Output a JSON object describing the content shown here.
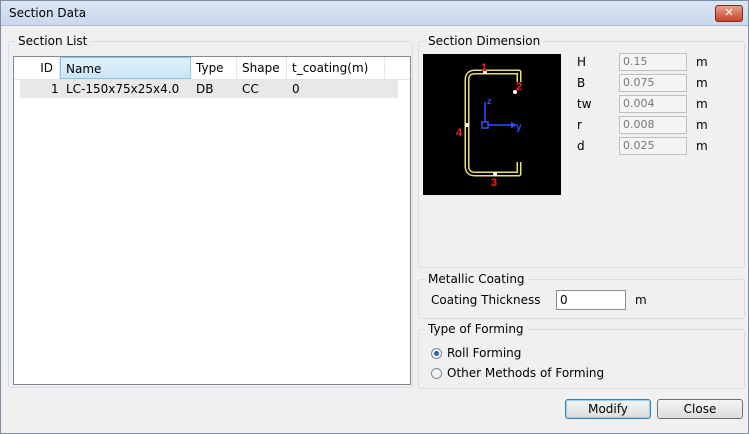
{
  "window": {
    "title": "Section Data",
    "close_symbol": "✕"
  },
  "section_list": {
    "label": "Section List",
    "columns": [
      "ID",
      "Name",
      "Type",
      "Shape",
      "t_coating(m)"
    ],
    "rows": [
      {
        "id": "1",
        "name": "LC-150x75x25x4.0",
        "type": "DB",
        "shape": "CC",
        "t_coating": "0"
      }
    ]
  },
  "section_dimension": {
    "label": "Section Dimension",
    "preview": {
      "axis_z": "z",
      "axis_y": "y",
      "point_1": "1",
      "point_2": "2",
      "point_3": "3",
      "point_4": "4"
    },
    "fields": [
      {
        "name": "H",
        "value": "0.15",
        "unit": "m"
      },
      {
        "name": "B",
        "value": "0.075",
        "unit": "m"
      },
      {
        "name": "tw",
        "value": "0.004",
        "unit": "m"
      },
      {
        "name": "r",
        "value": "0.008",
        "unit": "m"
      },
      {
        "name": "d",
        "value": "0.025",
        "unit": "m"
      }
    ]
  },
  "metallic_coating": {
    "label": "Metallic Coating",
    "thickness_label": "Coating Thickness",
    "thickness_value": "0",
    "unit": "m"
  },
  "forming": {
    "label": "Type of Forming",
    "options": [
      {
        "label": "Roll Forming",
        "selected": true
      },
      {
        "label": "Other Methods of Forming",
        "selected": false
      }
    ]
  },
  "buttons": {
    "modify": "Modify",
    "close": "Close"
  },
  "colors": {
    "shape_stroke": "#e8e07a",
    "marker": "#ff2020",
    "axis": "#3050ff"
  }
}
